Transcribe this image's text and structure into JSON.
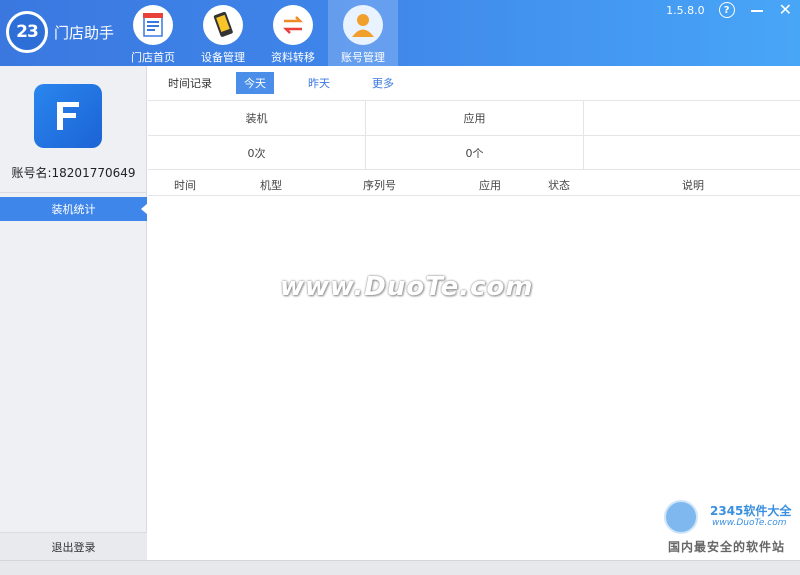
{
  "app": {
    "logo_number": "23",
    "logo_text": "门店助手",
    "version": "1.5.8.0",
    "help_glyph": "?",
    "accent_color": "#3f86ea"
  },
  "nav": {
    "items": [
      {
        "label": "门店首页",
        "icon": "store-icon"
      },
      {
        "label": "设备管理",
        "icon": "phone-icon"
      },
      {
        "label": "资料转移",
        "icon": "transfer-icon"
      },
      {
        "label": "账号管理",
        "icon": "user-icon",
        "active": true
      }
    ]
  },
  "sidebar": {
    "account_label": "账号名:18201770649",
    "menu": [
      {
        "label": "装机统计",
        "active": true
      }
    ],
    "logout_label": "退出登录"
  },
  "filter": {
    "label": "时间记录",
    "options": [
      "今天",
      "昨天",
      "更多"
    ],
    "selected": "今天"
  },
  "summary": {
    "headers": [
      "装机",
      "应用",
      ""
    ],
    "values": [
      "0次",
      "0个",
      ""
    ]
  },
  "table": {
    "columns": [
      "时间",
      "机型",
      "序列号",
      "应用",
      "状态",
      "说明"
    ],
    "rows": []
  },
  "watermark": {
    "main": "www.DuoTe.com",
    "brand": "2345软件大全",
    "site": "www.DuoTe.com",
    "tagline": "国内最安全的软件站"
  }
}
